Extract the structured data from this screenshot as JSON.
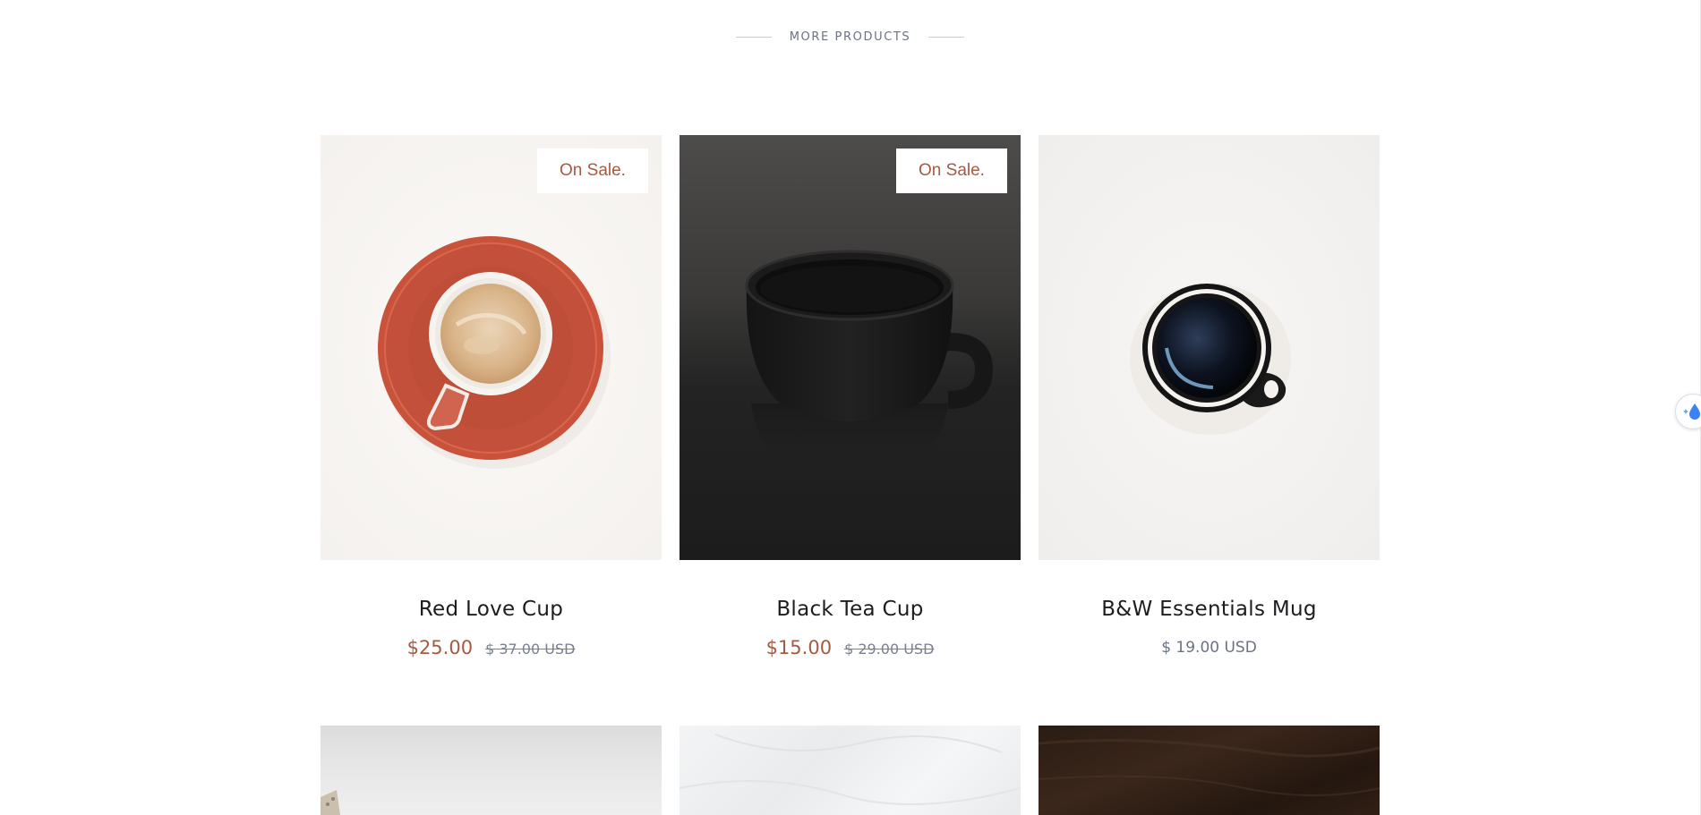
{
  "section": {
    "title": "MORE PRODUCTS"
  },
  "products": [
    {
      "name": "Red Love Cup",
      "badge": "On Sale.",
      "price": "$25.00",
      "compare_price": "$ 37.00 USD",
      "image_icon": "red-cup-image"
    },
    {
      "name": "Black Tea Cup",
      "badge": "On Sale.",
      "price": "$15.00",
      "compare_price": "$ 29.00 USD",
      "image_icon": "black-cup-image"
    },
    {
      "name": "B&W Essentials Mug",
      "price": "$ 19.00 USD",
      "image_icon": "bw-mug-image"
    }
  ],
  "colors": {
    "accent": "#a55a42",
    "muted_text": "#6b7283",
    "heading_text": "#1d1d1f",
    "widget_icon": "#3b82f6"
  },
  "widget": {
    "icon": "droplet-sparkle-icon"
  }
}
